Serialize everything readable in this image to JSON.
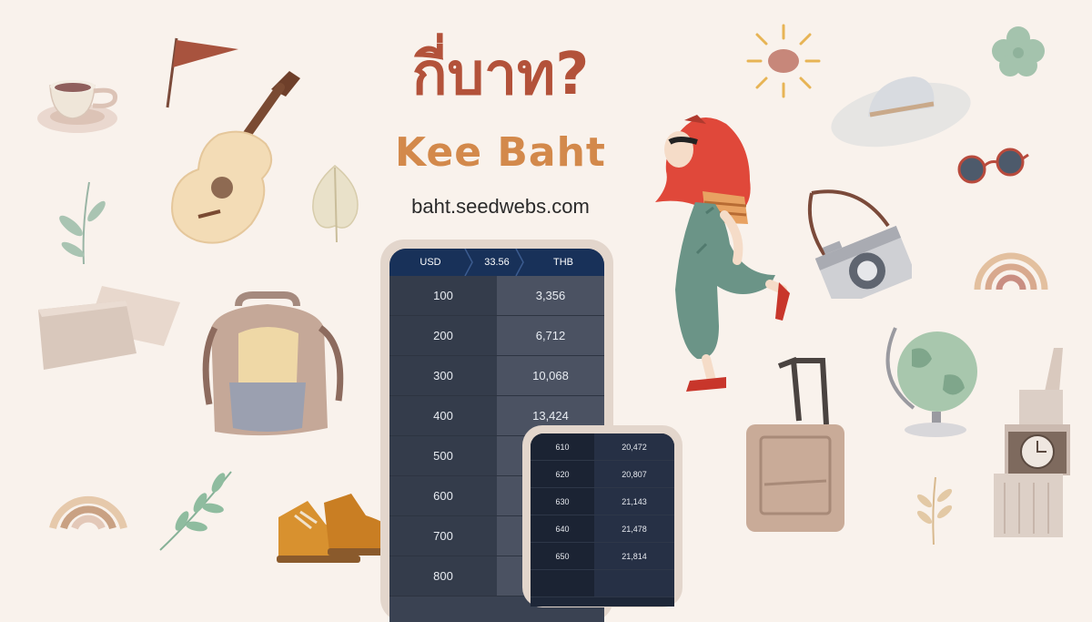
{
  "header": {
    "title_thai": "กี่บาท?",
    "title_en": "Kee Baht",
    "url": "baht.seedwebs.com"
  },
  "converter": {
    "from_currency": "USD",
    "rate": "33.56",
    "to_currency": "THB",
    "rows": [
      {
        "amount": "100",
        "result": "3,356"
      },
      {
        "amount": "200",
        "result": "6,712"
      },
      {
        "amount": "300",
        "result": "10,068"
      },
      {
        "amount": "400",
        "result": "13,424"
      },
      {
        "amount": "500",
        "result": ""
      },
      {
        "amount": "600",
        "result": ""
      },
      {
        "amount": "700",
        "result": ""
      },
      {
        "amount": "800",
        "result": ""
      }
    ]
  },
  "converter_zoom": {
    "rows": [
      {
        "amount": "610",
        "result": "20,472"
      },
      {
        "amount": "620",
        "result": "20,807"
      },
      {
        "amount": "630",
        "result": "21,143"
      },
      {
        "amount": "640",
        "result": "21,478"
      },
      {
        "amount": "650",
        "result": "21,814"
      },
      {
        "amount": "",
        "result": ""
      }
    ]
  },
  "colors": {
    "background": "#f9f2ec",
    "title_thai": "#b3523a",
    "title_en": "#d3894b",
    "header_bar": "#183159"
  },
  "decorations": [
    "teacup-icon",
    "pennant-flag-icon",
    "guitar-icon",
    "leaf-icon",
    "sprig-icon",
    "books-icon",
    "backpack-icon",
    "rainbow-icon",
    "sprig-icon",
    "boots-icon",
    "sun-icon",
    "flower-icon",
    "sunhat-icon",
    "sunglasses-icon",
    "camera-icon",
    "rainbow-icon",
    "globe-icon",
    "suitcase-icon",
    "big-ben-icon",
    "wheat-icon",
    "traveler-girl-illustration"
  ]
}
